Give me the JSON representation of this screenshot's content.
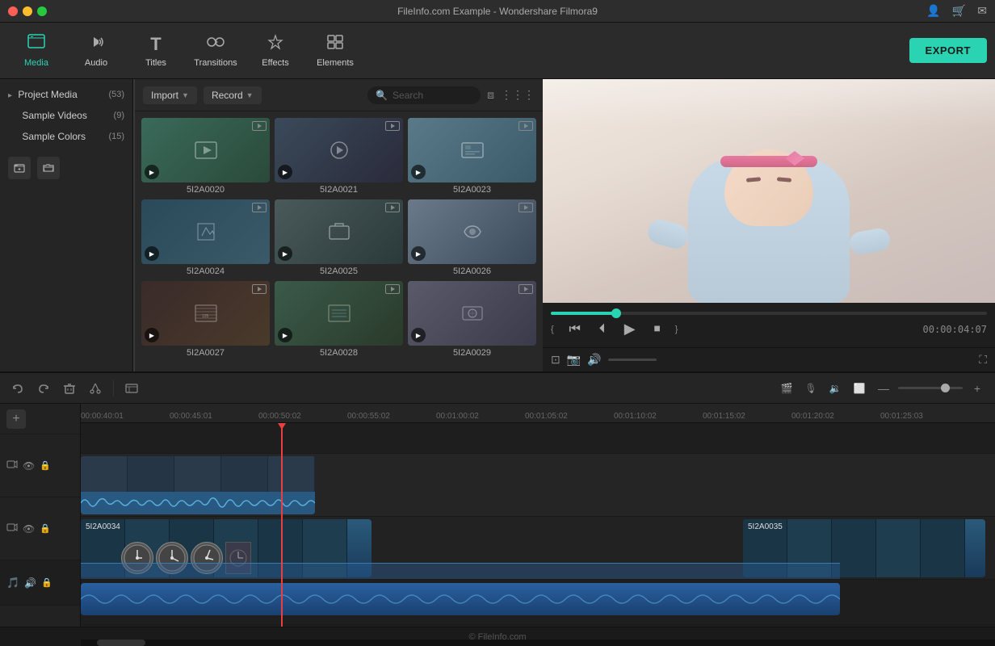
{
  "titlebar": {
    "title": "FileInfo.com Example - Wondershare Filmora9"
  },
  "titlebar_icons": [
    "👤",
    "🛒",
    "✉"
  ],
  "toolbar": {
    "export_label": "EXPORT",
    "items": [
      {
        "id": "media",
        "label": "Media",
        "icon": "📁",
        "active": true
      },
      {
        "id": "audio",
        "label": "Audio",
        "icon": "🎵",
        "active": false
      },
      {
        "id": "titles",
        "label": "Titles",
        "icon": "T",
        "active": false
      },
      {
        "id": "transitions",
        "label": "Transitions",
        "icon": "↔",
        "active": false
      },
      {
        "id": "effects",
        "label": "Effects",
        "icon": "✦",
        "active": false
      },
      {
        "id": "elements",
        "label": "Elements",
        "icon": "⊞",
        "active": false
      }
    ]
  },
  "left_panel": {
    "items": [
      {
        "label": "Project Media",
        "count": "(53)"
      },
      {
        "label": "Sample Videos",
        "count": "(9)"
      },
      {
        "label": "Sample Colors",
        "count": "(15)"
      }
    ]
  },
  "media_browser": {
    "import_label": "Import",
    "record_label": "Record",
    "search_placeholder": "Search",
    "items": [
      {
        "id": 1,
        "name": "5I2A0020"
      },
      {
        "id": 2,
        "name": "5I2A0021"
      },
      {
        "id": 3,
        "name": "5I2A0023"
      },
      {
        "id": 4,
        "name": "5I2A0024"
      },
      {
        "id": 5,
        "name": "5I2A0025"
      },
      {
        "id": 6,
        "name": "5I2A0026"
      },
      {
        "id": 7,
        "name": "5I2A0027"
      },
      {
        "id": 8,
        "name": "5I2A0028"
      },
      {
        "id": 9,
        "name": "5I2A0029"
      }
    ]
  },
  "preview": {
    "timecode": "00:00:04:07",
    "progress": 15
  },
  "timeline": {
    "toolbar_actions": [
      "undo",
      "redo",
      "delete",
      "cut",
      "list"
    ],
    "ruler_marks": [
      "00:00:40:01",
      "00:00:45:01",
      "00:00:50:02",
      "00:00:55:02",
      "00:01:00:02",
      "00:01:05:02",
      "00:01:10:02",
      "00:01:15:02",
      "00:01:20:02",
      "00:01:25:03"
    ],
    "clips": [
      {
        "id": "clip1",
        "label": "5I2A0034"
      },
      {
        "id": "clip2",
        "label": "5I2A0035"
      }
    ]
  },
  "copyright": "© FileInfo.com"
}
